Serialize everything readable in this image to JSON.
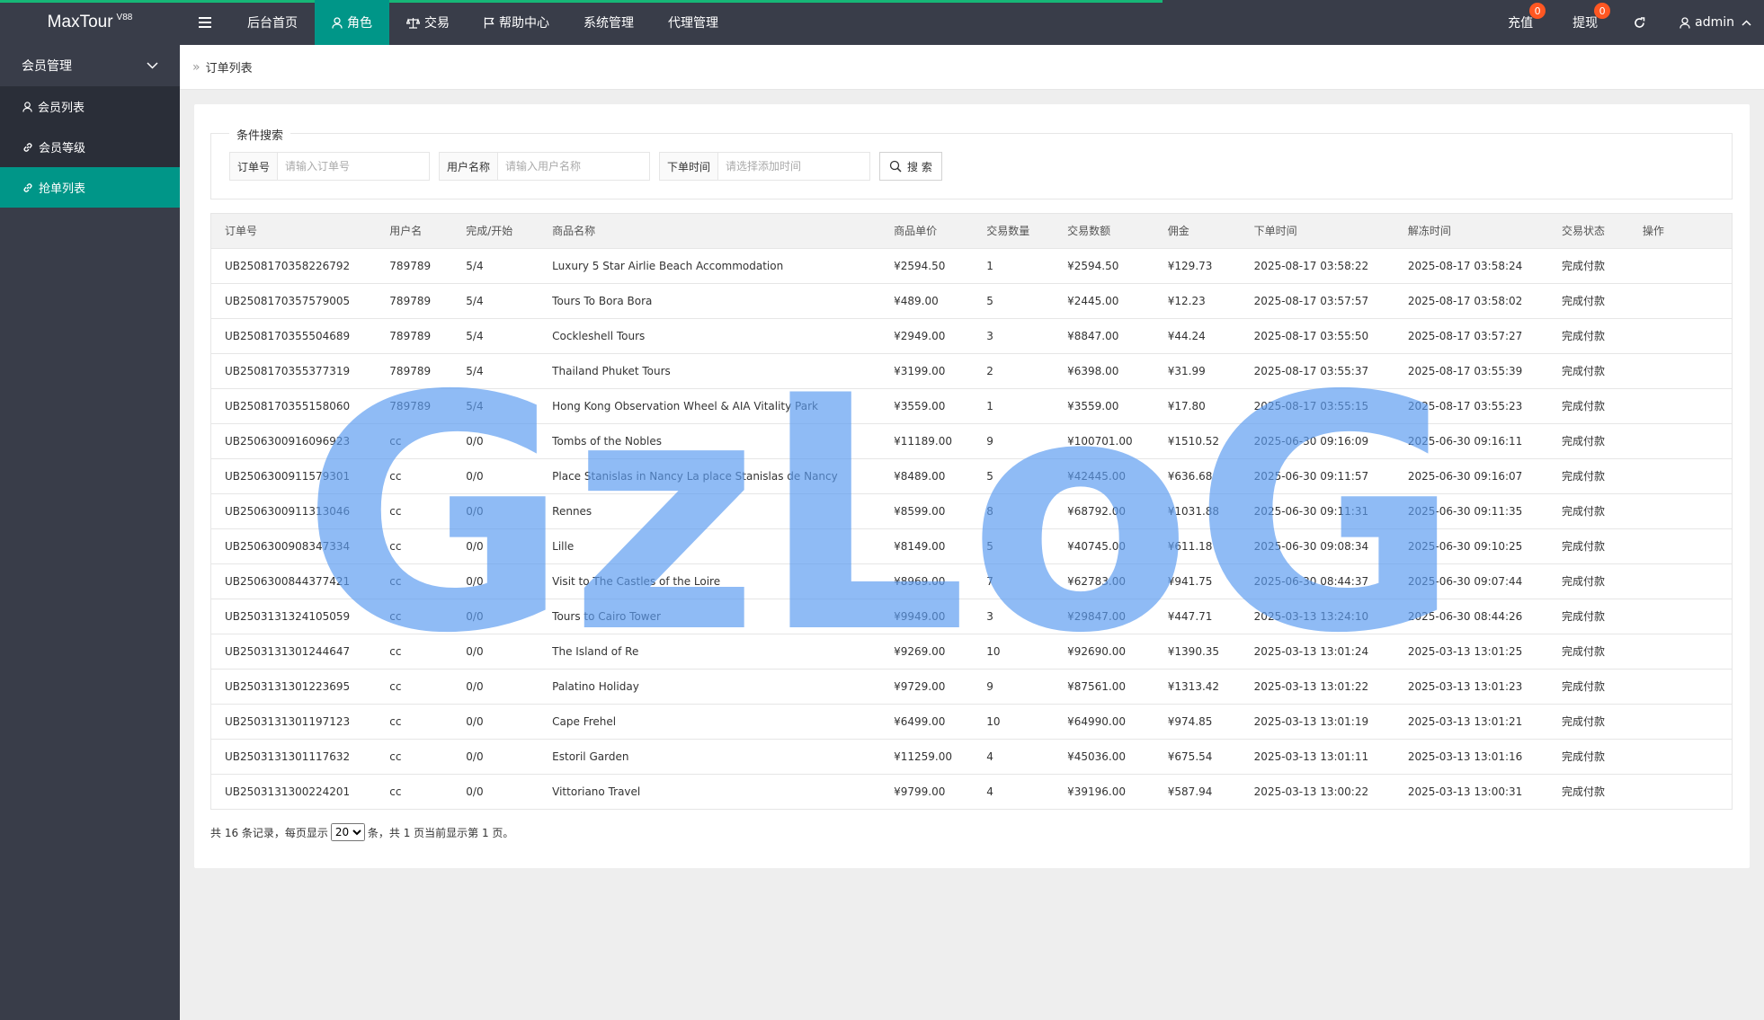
{
  "header": {
    "logo": "MaxTour",
    "logo_sup": "V88",
    "nav": [
      "后台首页",
      "角色",
      "交易",
      "帮助中心",
      "系统管理",
      "代理管理"
    ],
    "recharge": {
      "label": "充值",
      "badge": "0"
    },
    "withdraw": {
      "label": "提现",
      "badge": "0"
    },
    "admin": "admin"
  },
  "sidebar": {
    "group": "会员管理",
    "items": [
      "会员列表",
      "会员等级",
      "抢单列表"
    ]
  },
  "breadcrumb": "订单列表",
  "search": {
    "legend": "条件搜索",
    "order_label": "订单号",
    "order_placeholder": "请输入订单号",
    "user_label": "用户名称",
    "user_placeholder": "请输入用户名称",
    "time_label": "下单时间",
    "time_placeholder": "请选择添加时间",
    "button": "搜 索"
  },
  "table": {
    "columns": [
      "订单号",
      "用户名",
      "完成/开始",
      "商品名称",
      "商品单价",
      "交易数量",
      "交易数额",
      "佣金",
      "下单时间",
      "解冻时间",
      "交易状态",
      "操作"
    ],
    "rows": [
      [
        "UB2508170358226792",
        "789789",
        "5/4",
        "Luxury 5 Star Airlie Beach Accommodation",
        "¥2594.50",
        "1",
        "¥2594.50",
        "¥129.73",
        "2025-08-17 03:58:22",
        "2025-08-17 03:58:24",
        "完成付款",
        ""
      ],
      [
        "UB2508170357579005",
        "789789",
        "5/4",
        "Tours To Bora Bora",
        "¥489.00",
        "5",
        "¥2445.00",
        "¥12.23",
        "2025-08-17 03:57:57",
        "2025-08-17 03:58:02",
        "完成付款",
        ""
      ],
      [
        "UB2508170355504689",
        "789789",
        "5/4",
        "Cockleshell Tours",
        "¥2949.00",
        "3",
        "¥8847.00",
        "¥44.24",
        "2025-08-17 03:55:50",
        "2025-08-17 03:57:27",
        "完成付款",
        ""
      ],
      [
        "UB2508170355377319",
        "789789",
        "5/4",
        "Thailand Phuket Tours",
        "¥3199.00",
        "2",
        "¥6398.00",
        "¥31.99",
        "2025-08-17 03:55:37",
        "2025-08-17 03:55:39",
        "完成付款",
        ""
      ],
      [
        "UB2508170355158060",
        "789789",
        "5/4",
        "Hong Kong Observation Wheel & AIA Vitality Park",
        "¥3559.00",
        "1",
        "¥3559.00",
        "¥17.80",
        "2025-08-17 03:55:15",
        "2025-08-17 03:55:23",
        "完成付款",
        ""
      ],
      [
        "UB2506300916096923",
        "cc",
        "0/0",
        "Tombs of the Nobles",
        "¥11189.00",
        "9",
        "¥100701.00",
        "¥1510.52",
        "2025-06-30 09:16:09",
        "2025-06-30 09:16:11",
        "完成付款",
        ""
      ],
      [
        "UB2506300911579301",
        "cc",
        "0/0",
        "Place Stanislas in Nancy La place Stanislas de Nancy",
        "¥8489.00",
        "5",
        "¥42445.00",
        "¥636.68",
        "2025-06-30 09:11:57",
        "2025-06-30 09:16:07",
        "完成付款",
        ""
      ],
      [
        "UB2506300911313046",
        "cc",
        "0/0",
        "Rennes",
        "¥8599.00",
        "8",
        "¥68792.00",
        "¥1031.88",
        "2025-06-30 09:11:31",
        "2025-06-30 09:11:35",
        "完成付款",
        ""
      ],
      [
        "UB2506300908347334",
        "cc",
        "0/0",
        "Lille",
        "¥8149.00",
        "5",
        "¥40745.00",
        "¥611.18",
        "2025-06-30 09:08:34",
        "2025-06-30 09:10:25",
        "完成付款",
        ""
      ],
      [
        "UB2506300844377421",
        "cc",
        "0/0",
        "Visit to The Castles of the Loire",
        "¥8969.00",
        "7",
        "¥62783.00",
        "¥941.75",
        "2025-06-30 08:44:37",
        "2025-06-30 09:07:44",
        "完成付款",
        ""
      ],
      [
        "UB2503131324105059",
        "cc",
        "0/0",
        "Tours to Cairo Tower",
        "¥9949.00",
        "3",
        "¥29847.00",
        "¥447.71",
        "2025-03-13 13:24:10",
        "2025-06-30 08:44:26",
        "完成付款",
        ""
      ],
      [
        "UB2503131301244647",
        "cc",
        "0/0",
        "The Island of Re",
        "¥9269.00",
        "10",
        "¥92690.00",
        "¥1390.35",
        "2025-03-13 13:01:24",
        "2025-03-13 13:01:25",
        "完成付款",
        ""
      ],
      [
        "UB2503131301223695",
        "cc",
        "0/0",
        "Palatino Holiday",
        "¥9729.00",
        "9",
        "¥87561.00",
        "¥1313.42",
        "2025-03-13 13:01:22",
        "2025-03-13 13:01:23",
        "完成付款",
        ""
      ],
      [
        "UB2503131301197123",
        "cc",
        "0/0",
        "Cape Frehel",
        "¥6499.00",
        "10",
        "¥64990.00",
        "¥974.85",
        "2025-03-13 13:01:19",
        "2025-03-13 13:01:21",
        "完成付款",
        ""
      ],
      [
        "UB2503131301117632",
        "cc",
        "0/0",
        "Estoril Garden",
        "¥11259.00",
        "4",
        "¥45036.00",
        "¥675.54",
        "2025-03-13 13:01:11",
        "2025-03-13 13:01:16",
        "完成付款",
        ""
      ],
      [
        "UB2503131300224201",
        "cc",
        "0/0",
        "Vittoriano Travel",
        "¥9799.00",
        "4",
        "¥39196.00",
        "¥587.94",
        "2025-03-13 13:00:22",
        "2025-03-13 13:00:31",
        "完成付款",
        ""
      ]
    ]
  },
  "pager": {
    "prefix": "共 16 条记录，每页显示",
    "page_size": "20",
    "suffix": "条，共 1 页当前显示第 1 页。"
  },
  "watermark": "GzLoG",
  "colors": {
    "header_bg": "#393d49",
    "accent": "#009688",
    "badge": "#ff5722",
    "watermark": "#5a9bf0"
  }
}
